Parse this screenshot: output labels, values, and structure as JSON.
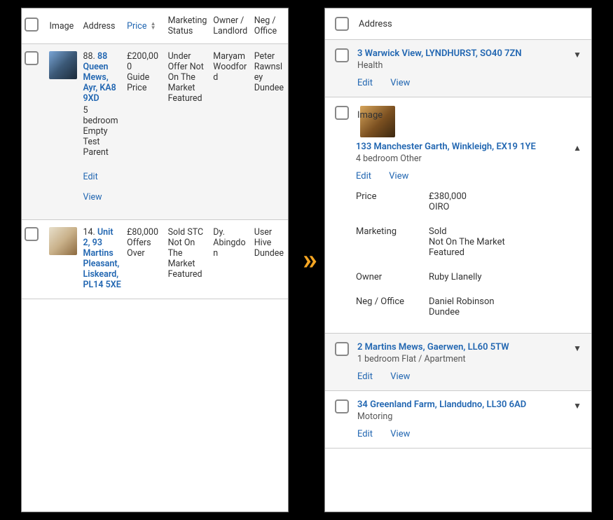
{
  "left": {
    "columns": {
      "image": "Image",
      "address": "Address",
      "price": "Price",
      "marketing": "Marketing Status",
      "owner": "Owner / Landlord",
      "neg": "Neg / Office"
    },
    "rows": [
      {
        "row_num": "88.",
        "address": "88 Queen Mews, Ayr, KA8 9XD",
        "summary": "5 bedroom Empty Test Parent",
        "price_line1": "£200,000",
        "price_line2": "Guide Price",
        "marketing": "Under Offer Not On The Market Featured",
        "owner": "Maryam Woodford",
        "neg": "Peter Rawnsley Dundee",
        "thumb_class": "thumb"
      },
      {
        "row_num": "14.",
        "address": "Unit 2, 93 Martins Pleasant, Liskeard, PL14 5XE",
        "summary": "",
        "price_line1": "£80,000",
        "price_line2": "Offers Over",
        "marketing": "Sold STC Not On The Market Featured",
        "owner": "Dy. Abingdon",
        "neg": "User Hive Dundee",
        "thumb_class": "thumb interior"
      }
    ],
    "edit": "Edit",
    "view": "View"
  },
  "right": {
    "header": "Address",
    "cards": [
      {
        "title": "3 Warwick View, LYNDHURST, SO40 7ZN",
        "subtitle": "Health",
        "expanded": false,
        "alt": true
      },
      {
        "title": "133 Manchester Garth, Winkleigh, EX19 1YE",
        "subtitle": "4 bedroom Other",
        "expanded": true,
        "alt": false,
        "image_label": "Image",
        "details": {
          "price_label": "Price",
          "price_value": "£380,000\nOIRO",
          "marketing_label": "Marketing",
          "marketing_value": "Sold\nNot On The Market\nFeatured",
          "owner_label": "Owner",
          "owner_value": "Ruby Llanelly",
          "neg_label": "Neg / Office",
          "neg_value": "Daniel Robinson\nDundee"
        }
      },
      {
        "title": "2 Martins Mews, Gaerwen, LL60 5TW",
        "subtitle": "1 bedroom Flat / Apartment",
        "expanded": false,
        "alt": true,
        "odd": true
      },
      {
        "title": "34 Greenland Farm, Llandudno, LL30 6AD",
        "subtitle": "Motoring",
        "expanded": false,
        "alt": false
      }
    ],
    "edit": "Edit",
    "view": "View"
  }
}
